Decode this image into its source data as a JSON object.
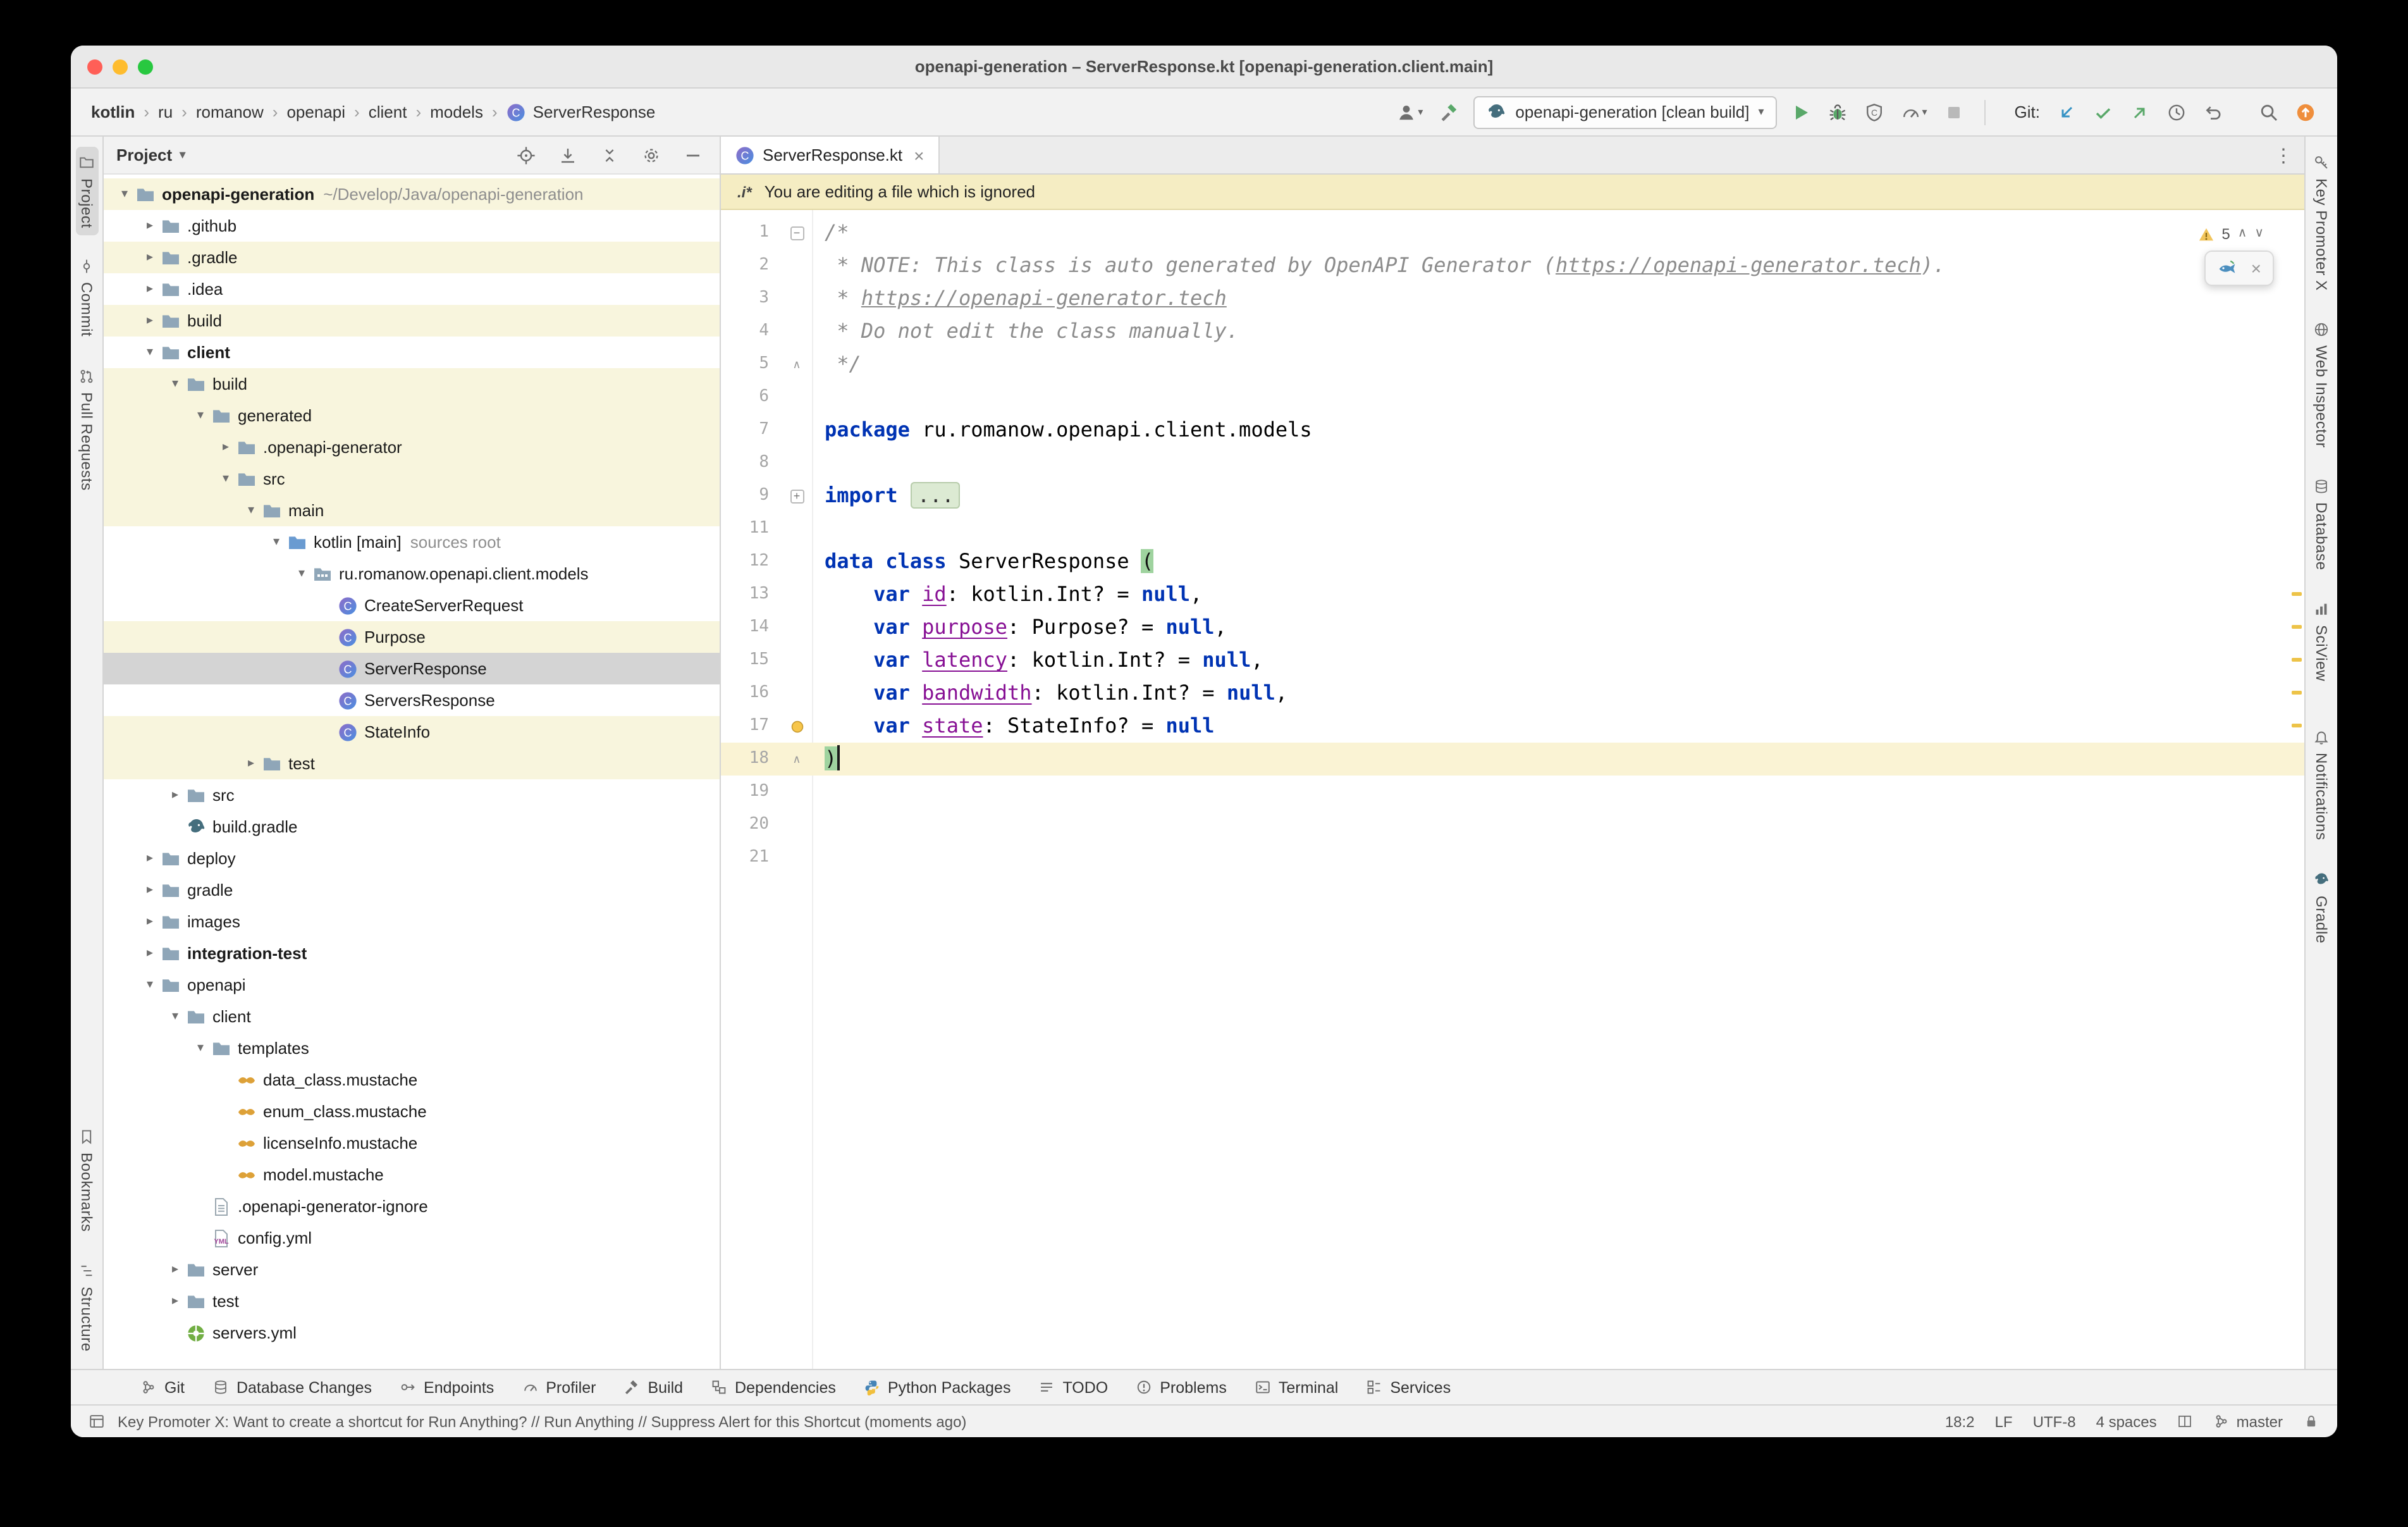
{
  "window_title": "openapi-generation – ServerResponse.kt [openapi-generation.client.main]",
  "breadcrumbs": {
    "items": [
      "kotlin",
      "ru",
      "romanow",
      "openapi",
      "client",
      "models",
      "ServerResponse"
    ]
  },
  "toolbar": {
    "run_config": "openapi-generation [clean build]",
    "git_label": "Git:",
    "left_icons": [
      "user-icon",
      "hammer-icon"
    ],
    "run_icons": [
      "run-icon",
      "debug-icon",
      "coverage-icon",
      "profiler-icon",
      "stop-icon"
    ],
    "git_icons": [
      "vcs-update-icon",
      "vcs-commit-icon",
      "vcs-push-icon",
      "history-icon",
      "rollback-icon"
    ],
    "far_icons": [
      "search-icon",
      "ide-update-icon"
    ]
  },
  "stripes": {
    "left_top": [
      {
        "label": "Project",
        "icon": "project-icon",
        "active": true
      },
      {
        "label": "Commit",
        "icon": "commit-icon"
      },
      {
        "label": "Pull Requests",
        "icon": "pull-request-icon"
      }
    ],
    "left_bottom": [
      {
        "label": "Bookmarks",
        "icon": "bookmarks-icon"
      },
      {
        "label": "Structure",
        "icon": "structure-icon"
      }
    ],
    "right_top": [
      {
        "label": "Key Promoter X",
        "icon": "key-icon"
      },
      {
        "label": "Web Inspector",
        "icon": "globe-icon"
      },
      {
        "label": "Database",
        "icon": "database-icon"
      },
      {
        "label": "SciView",
        "icon": "chart-icon"
      },
      {
        "label": "Notifications",
        "icon": "bell-icon"
      },
      {
        "label": "Gradle",
        "icon": "gradle-icon"
      }
    ]
  },
  "project_panel": {
    "title": "Project",
    "header_icons": [
      "locate-icon",
      "expand-selection-icon",
      "collapse-all-icon",
      "settings-icon",
      "hide-icon"
    ],
    "tree": [
      {
        "label": "openapi-generation",
        "level": 0,
        "icon": "folder-icon",
        "arrow": "down",
        "bold": true,
        "suffix": "~/Develop/Java/openapi-generation",
        "ignored": true
      },
      {
        "label": ".github",
        "level": 1,
        "icon": "folder-icon",
        "arrow": "right"
      },
      {
        "label": ".gradle",
        "level": 1,
        "icon": "folder-icon",
        "arrow": "right",
        "ignored": true
      },
      {
        "label": ".idea",
        "level": 1,
        "icon": "folder-icon",
        "arrow": "right"
      },
      {
        "label": "build",
        "level": 1,
        "icon": "folder-icon",
        "arrow": "right",
        "ignored": true
      },
      {
        "label": "client",
        "level": 1,
        "icon": "folder-icon",
        "arrow": "down",
        "bold": true
      },
      {
        "label": "build",
        "level": 2,
        "icon": "folder-icon",
        "arrow": "down",
        "ignored": true
      },
      {
        "label": "generated",
        "level": 3,
        "icon": "folder-icon",
        "arrow": "down",
        "ignored": true
      },
      {
        "label": ".openapi-generator",
        "level": 4,
        "icon": "folder-icon",
        "arrow": "right",
        "ignored": true
      },
      {
        "label": "src",
        "level": 4,
        "icon": "folder-icon",
        "arrow": "down",
        "ignored": true
      },
      {
        "label": "main",
        "level": 5,
        "icon": "folder-icon",
        "arrow": "down",
        "ignored": true
      },
      {
        "label": "kotlin [main]",
        "level": 6,
        "icon": "sources-root-icon",
        "arrow": "down",
        "suffix": "sources root"
      },
      {
        "label": "ru.romanow.openapi.client.models",
        "level": 7,
        "icon": "package-icon",
        "arrow": "down"
      },
      {
        "label": "CreateServerRequest",
        "level": 8,
        "icon": "kotlin-class-icon"
      },
      {
        "label": "Purpose",
        "level": 8,
        "icon": "kotlin-class-icon",
        "ignored": true
      },
      {
        "label": "ServerResponse",
        "level": 8,
        "icon": "kotlin-class-icon",
        "selected": true
      },
      {
        "label": "ServersResponse",
        "level": 8,
        "icon": "kotlin-class-icon"
      },
      {
        "label": "StateInfo",
        "level": 8,
        "icon": "kotlin-class-icon",
        "ignored": true
      },
      {
        "label": "test",
        "level": 5,
        "icon": "folder-icon",
        "arrow": "right",
        "ignored": true
      },
      {
        "label": "src",
        "level": 2,
        "icon": "folder-icon",
        "arrow": "right"
      },
      {
        "label": "build.gradle",
        "level": 2,
        "icon": "gradle-file-icon"
      },
      {
        "label": "deploy",
        "level": 1,
        "icon": "folder-icon",
        "arrow": "right"
      },
      {
        "label": "gradle",
        "level": 1,
        "icon": "folder-icon",
        "arrow": "right"
      },
      {
        "label": "images",
        "level": 1,
        "icon": "folder-icon",
        "arrow": "right"
      },
      {
        "label": "integration-test",
        "level": 1,
        "icon": "folder-icon",
        "arrow": "right",
        "bold": true
      },
      {
        "label": "openapi",
        "level": 1,
        "icon": "folder-icon",
        "arrow": "down"
      },
      {
        "label": "client",
        "level": 2,
        "icon": "folder-icon",
        "arrow": "down"
      },
      {
        "label": "templates",
        "level": 3,
        "icon": "folder-icon",
        "arrow": "down"
      },
      {
        "label": "data_class.mustache",
        "level": 4,
        "icon": "mustache-icon"
      },
      {
        "label": "enum_class.mustache",
        "level": 4,
        "icon": "mustache-icon"
      },
      {
        "label": "licenseInfo.mustache",
        "level": 4,
        "icon": "mustache-icon"
      },
      {
        "label": "model.mustache",
        "level": 4,
        "icon": "mustache-icon"
      },
      {
        "label": ".openapi-generator-ignore",
        "level": 3,
        "icon": "text-file-icon"
      },
      {
        "label": "config.yml",
        "level": 3,
        "icon": "yaml-file-icon"
      },
      {
        "label": "server",
        "level": 2,
        "icon": "folder-icon",
        "arrow": "right"
      },
      {
        "label": "test",
        "level": 2,
        "icon": "folder-icon",
        "arrow": "right"
      },
      {
        "label": "servers.yml",
        "level": 2,
        "icon": "openapi-file-icon"
      }
    ]
  },
  "editor": {
    "tab": {
      "label": "ServerResponse.kt",
      "icon": "kotlin-class-icon"
    },
    "banner": {
      "icon": "ignore-plugin-icon",
      "icon_text": ".i*",
      "text": "You are editing a file which is ignored"
    },
    "inspection": {
      "count": "5"
    },
    "warning_lines": [
      13,
      14,
      15,
      16,
      17
    ],
    "lines": [
      {
        "n": "1",
        "fold": "open",
        "t": [
          [
            "c",
            "/*"
          ]
        ]
      },
      {
        "n": "2",
        "t": [
          [
            "c",
            " * NOTE: This class is auto generated by OpenAPI Generator ("
          ],
          [
            "cl",
            "https://openapi-generator.tech"
          ],
          [
            "c",
            ")."
          ]
        ]
      },
      {
        "n": "3",
        "t": [
          [
            "c",
            " * "
          ],
          [
            "cl",
            "https://openapi-generator.tech"
          ]
        ]
      },
      {
        "n": "4",
        "t": [
          [
            "c",
            " * Do not edit the class manually."
          ]
        ]
      },
      {
        "n": "5",
        "fold": "end",
        "t": [
          [
            "c",
            " */"
          ]
        ]
      },
      {
        "n": "6",
        "t": []
      },
      {
        "n": "7",
        "t": [
          [
            "k",
            "package"
          ],
          [
            "p",
            " ru.romanow.openapi.client.models"
          ]
        ]
      },
      {
        "n": "8",
        "t": []
      },
      {
        "n": "9",
        "fold": "closed",
        "t": [
          [
            "k",
            "import"
          ],
          [
            "p",
            " "
          ],
          [
            "f",
            "..."
          ]
        ]
      },
      {
        "n": "11",
        "t": []
      },
      {
        "n": "12",
        "t": [
          [
            "k",
            "data"
          ],
          [
            "p",
            " "
          ],
          [
            "k",
            "class"
          ],
          [
            "p",
            " ServerResponse "
          ],
          [
            "bh",
            "("
          ]
        ]
      },
      {
        "n": "13",
        "t": [
          [
            "p",
            "    "
          ],
          [
            "k",
            "var"
          ],
          [
            "p",
            " "
          ],
          [
            "u",
            "id"
          ],
          [
            "p",
            ": kotlin.Int? = "
          ],
          [
            "k",
            "null"
          ],
          [
            "p",
            ","
          ]
        ]
      },
      {
        "n": "14",
        "t": [
          [
            "p",
            "    "
          ],
          [
            "k",
            "var"
          ],
          [
            "p",
            " "
          ],
          [
            "u",
            "purpose"
          ],
          [
            "p",
            ": Purpose? = "
          ],
          [
            "k",
            "null"
          ],
          [
            "p",
            ","
          ]
        ]
      },
      {
        "n": "15",
        "t": [
          [
            "p",
            "    "
          ],
          [
            "k",
            "var"
          ],
          [
            "p",
            " "
          ],
          [
            "u",
            "latency"
          ],
          [
            "p",
            ": kotlin.Int? = "
          ],
          [
            "k",
            "null"
          ],
          [
            "p",
            ","
          ]
        ]
      },
      {
        "n": "16",
        "t": [
          [
            "p",
            "    "
          ],
          [
            "k",
            "var"
          ],
          [
            "p",
            " "
          ],
          [
            "u",
            "bandwidth"
          ],
          [
            "p",
            ": kotlin.Int? = "
          ],
          [
            "k",
            "null"
          ],
          [
            "p",
            ","
          ]
        ]
      },
      {
        "n": "17",
        "fold": "bulb",
        "t": [
          [
            "p",
            "    "
          ],
          [
            "k",
            "var"
          ],
          [
            "p",
            " "
          ],
          [
            "u",
            "state"
          ],
          [
            "p",
            ": StateInfo? = "
          ],
          [
            "k",
            "null"
          ]
        ]
      },
      {
        "n": "18",
        "fold": "end",
        "current": true,
        "caret": true,
        "t": [
          [
            "bh",
            ")"
          ]
        ]
      },
      {
        "n": "19",
        "t": []
      },
      {
        "n": "20",
        "t": []
      },
      {
        "n": "21",
        "t": []
      }
    ]
  },
  "bottom_tools": [
    {
      "label": "Git",
      "icon": "git-icon"
    },
    {
      "label": "Database Changes",
      "icon": "database-icon"
    },
    {
      "label": "Endpoints",
      "icon": "endpoints-icon"
    },
    {
      "label": "Profiler",
      "icon": "profiler-icon"
    },
    {
      "label": "Build",
      "icon": "build-icon"
    },
    {
      "label": "Dependencies",
      "icon": "dependencies-icon"
    },
    {
      "label": "Python Packages",
      "icon": "python-icon"
    },
    {
      "label": "TODO",
      "icon": "todo-icon"
    },
    {
      "label": "Problems",
      "icon": "problems-icon"
    },
    {
      "label": "Terminal",
      "icon": "terminal-icon"
    },
    {
      "label": "Services",
      "icon": "services-icon"
    }
  ],
  "status_bar": {
    "message": "Key Promoter X: Want to create a shortcut for Run Anything? // Run Anything // Suppress Alert for this Shortcut (moments ago)",
    "caret": "18:2",
    "line_ending": "LF",
    "encoding": "UTF-8",
    "indent": "4 spaces",
    "branch": "master"
  },
  "colors": {
    "keyword": "#0033b3",
    "property": "#871094",
    "comment": "#8c8c8c",
    "selection_row": "#d4d4d4",
    "ignored_row": "#f8f5dd",
    "current_line": "#faf3d4",
    "banner_bg": "#f5edc3",
    "accent_orange": "#ef8e3c",
    "run_green": "#59a869",
    "vcs_blue": "#3592c4"
  }
}
